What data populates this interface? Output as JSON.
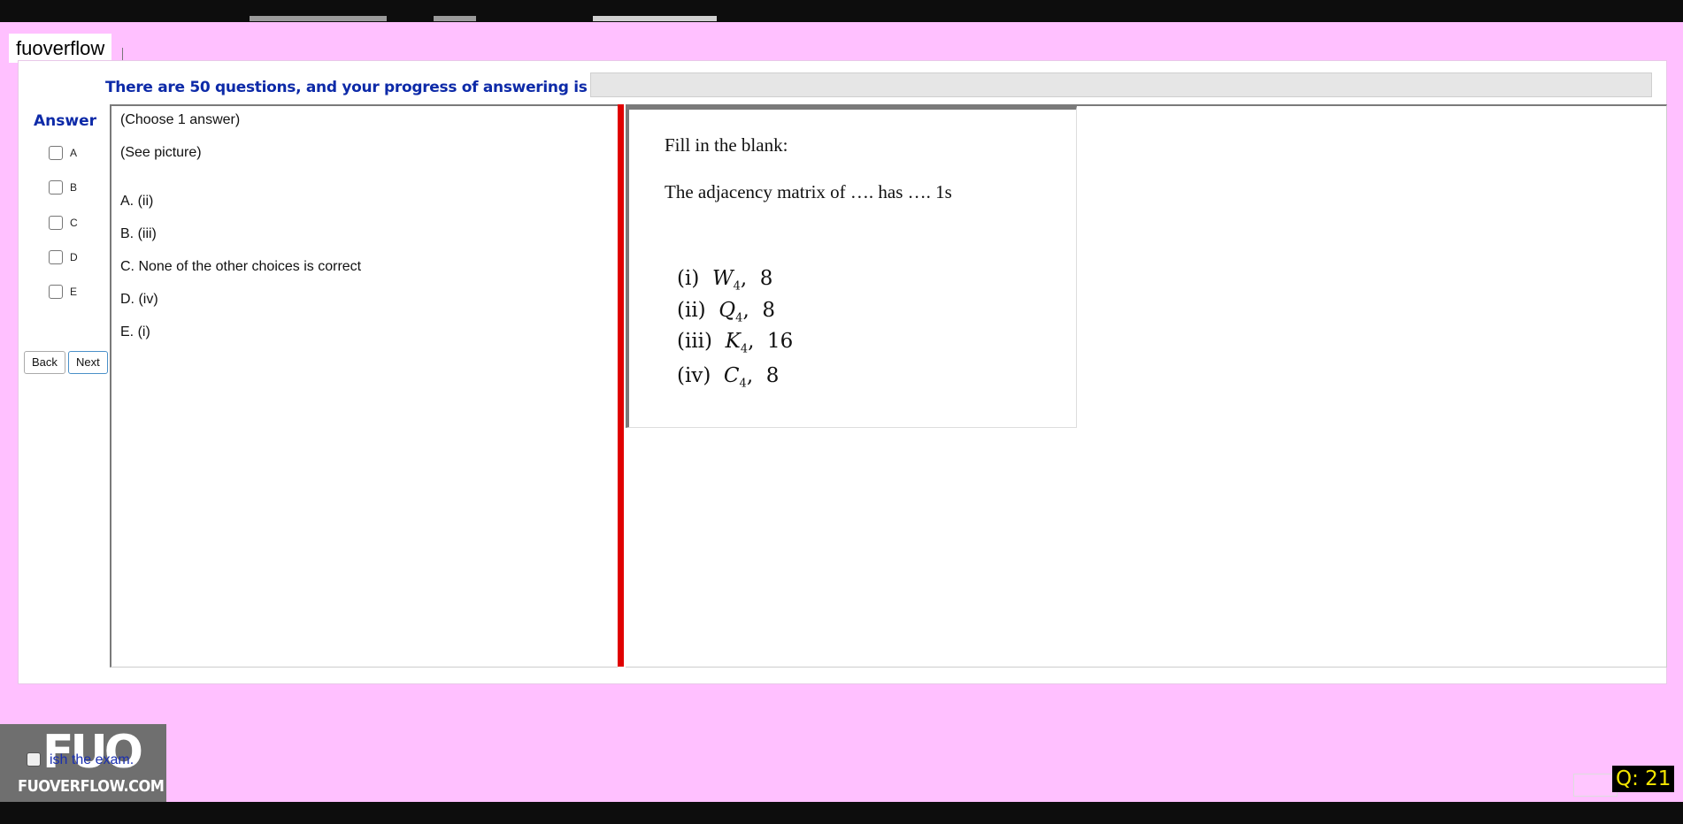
{
  "watermark_text": "fuoverflow",
  "progress": {
    "text": "There are 50 questions, and your progress of answering is",
    "fraction": 0
  },
  "answer": {
    "label": "Answer",
    "options": [
      "A",
      "B",
      "C",
      "D",
      "E"
    ]
  },
  "nav": {
    "back": "Back",
    "next": "Next"
  },
  "question": {
    "instruction": "(Choose 1 answer)",
    "note": "(See picture)",
    "choices": [
      "A.  (ii)",
      "B.  (iii)",
      "C.  None of the other choices is correct",
      "D.  (iv)",
      "E.  (i)"
    ]
  },
  "figure": {
    "heading": "Fill in the blank:",
    "statement": "The adjacency matrix of …. has …. 1s",
    "items": [
      {
        "num": "(i)",
        "graph": "W",
        "sub": "4",
        "value": "8"
      },
      {
        "num": "(ii)",
        "graph": "Q",
        "sub": "4",
        "value": "8"
      },
      {
        "num": "(iii)",
        "graph": "K",
        "sub": "4",
        "value": "16"
      },
      {
        "num": "(iv)",
        "graph": "C",
        "sub": "4",
        "value": "8"
      }
    ]
  },
  "logo": {
    "mark": "FUO",
    "text": "FUOVERFLOW.COM"
  },
  "finish_text": "ish the exam.",
  "question_badge": "Q: 21"
}
